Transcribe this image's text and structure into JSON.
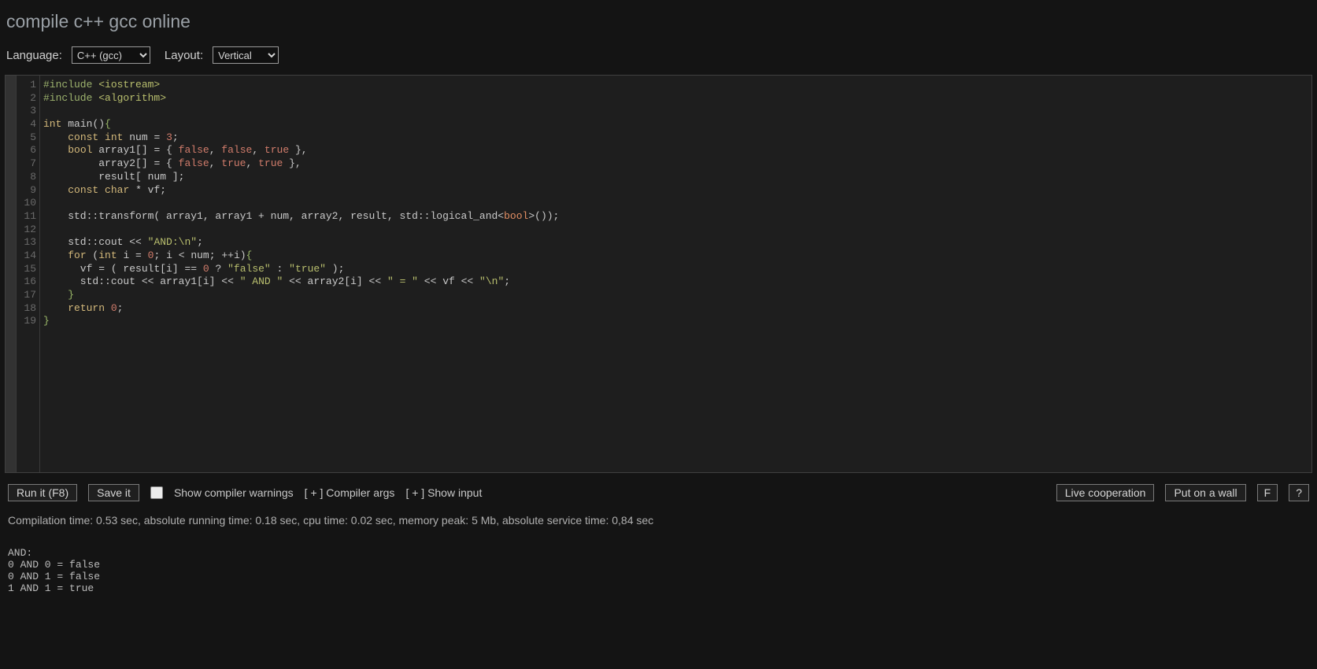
{
  "page": {
    "title": "compile c++ gcc online"
  },
  "toolbar": {
    "language_label": "Language:",
    "language_value": "C++ (gcc)",
    "layout_label": "Layout:",
    "layout_value": "Vertical"
  },
  "editor": {
    "line_count": 19,
    "lines": [
      [
        {
          "t": "#include ",
          "c": "dir"
        },
        {
          "t": "<iostream>",
          "c": "str"
        }
      ],
      [
        {
          "t": "#include ",
          "c": "dir"
        },
        {
          "t": "<algorithm>",
          "c": "str"
        }
      ],
      [
        {
          "t": "",
          "c": "id"
        }
      ],
      [
        {
          "t": "int",
          "c": "type"
        },
        {
          "t": " ",
          "c": "id"
        },
        {
          "t": "main",
          "c": "fn"
        },
        {
          "t": "()",
          "c": "op"
        },
        {
          "t": "{",
          "c": "br"
        }
      ],
      [
        {
          "t": "    ",
          "c": "id"
        },
        {
          "t": "const",
          "c": "kw"
        },
        {
          "t": " ",
          "c": "id"
        },
        {
          "t": "int",
          "c": "type"
        },
        {
          "t": " num ",
          "c": "id"
        },
        {
          "t": "=",
          "c": "op"
        },
        {
          "t": " ",
          "c": "id"
        },
        {
          "t": "3",
          "c": "num"
        },
        {
          "t": ";",
          "c": "op"
        }
      ],
      [
        {
          "t": "    ",
          "c": "id"
        },
        {
          "t": "bool",
          "c": "type"
        },
        {
          "t": " array1[] ",
          "c": "id"
        },
        {
          "t": "=",
          "c": "op"
        },
        {
          "t": " { ",
          "c": "op"
        },
        {
          "t": "false",
          "c": "bool"
        },
        {
          "t": ", ",
          "c": "op"
        },
        {
          "t": "false",
          "c": "bool"
        },
        {
          "t": ", ",
          "c": "op"
        },
        {
          "t": "true",
          "c": "bool"
        },
        {
          "t": " },",
          "c": "op"
        }
      ],
      [
        {
          "t": "         array2[] ",
          "c": "id"
        },
        {
          "t": "=",
          "c": "op"
        },
        {
          "t": " { ",
          "c": "op"
        },
        {
          "t": "false",
          "c": "bool"
        },
        {
          "t": ", ",
          "c": "op"
        },
        {
          "t": "true",
          "c": "bool"
        },
        {
          "t": ", ",
          "c": "op"
        },
        {
          "t": "true",
          "c": "bool"
        },
        {
          "t": " },",
          "c": "op"
        }
      ],
      [
        {
          "t": "         result[ num ];",
          "c": "id"
        }
      ],
      [
        {
          "t": "    ",
          "c": "id"
        },
        {
          "t": "const",
          "c": "kw"
        },
        {
          "t": " ",
          "c": "id"
        },
        {
          "t": "char",
          "c": "type"
        },
        {
          "t": " * vf;",
          "c": "id"
        }
      ],
      [
        {
          "t": "",
          "c": "id"
        }
      ],
      [
        {
          "t": "    std::transform( array1, array1 + num, array2, result, std::logical_and",
          "c": "id"
        },
        {
          "t": "<",
          "c": "op"
        },
        {
          "t": "bool",
          "c": "tmpl"
        },
        {
          "t": ">",
          "c": "op"
        },
        {
          "t": "());",
          "c": "id"
        }
      ],
      [
        {
          "t": "",
          "c": "id"
        }
      ],
      [
        {
          "t": "    std::cout ",
          "c": "id"
        },
        {
          "t": "<<",
          "c": "op"
        },
        {
          "t": " ",
          "c": "id"
        },
        {
          "t": "\"AND:\\n\"",
          "c": "str"
        },
        {
          "t": ";",
          "c": "op"
        }
      ],
      [
        {
          "t": "    ",
          "c": "id"
        },
        {
          "t": "for",
          "c": "kw"
        },
        {
          "t": " (",
          "c": "op"
        },
        {
          "t": "int",
          "c": "type"
        },
        {
          "t": " i ",
          "c": "id"
        },
        {
          "t": "=",
          "c": "op"
        },
        {
          "t": " ",
          "c": "id"
        },
        {
          "t": "0",
          "c": "num"
        },
        {
          "t": "; i ",
          "c": "id"
        },
        {
          "t": "<",
          "c": "op"
        },
        {
          "t": " num; ",
          "c": "id"
        },
        {
          "t": "++",
          "c": "op"
        },
        {
          "t": "i)",
          "c": "id"
        },
        {
          "t": "{",
          "c": "br"
        }
      ],
      [
        {
          "t": "      vf ",
          "c": "id"
        },
        {
          "t": "=",
          "c": "op"
        },
        {
          "t": " ( result[i] ",
          "c": "id"
        },
        {
          "t": "==",
          "c": "op"
        },
        {
          "t": " ",
          "c": "id"
        },
        {
          "t": "0",
          "c": "num"
        },
        {
          "t": " ",
          "c": "id"
        },
        {
          "t": "?",
          "c": "op"
        },
        {
          "t": " ",
          "c": "id"
        },
        {
          "t": "\"false\"",
          "c": "str"
        },
        {
          "t": " ",
          "c": "id"
        },
        {
          "t": ":",
          "c": "op"
        },
        {
          "t": " ",
          "c": "id"
        },
        {
          "t": "\"true\"",
          "c": "str"
        },
        {
          "t": " );",
          "c": "id"
        }
      ],
      [
        {
          "t": "      std::cout ",
          "c": "id"
        },
        {
          "t": "<<",
          "c": "op"
        },
        {
          "t": " array1[i] ",
          "c": "id"
        },
        {
          "t": "<<",
          "c": "op"
        },
        {
          "t": " ",
          "c": "id"
        },
        {
          "t": "\" AND \"",
          "c": "str"
        },
        {
          "t": " ",
          "c": "id"
        },
        {
          "t": "<<",
          "c": "op"
        },
        {
          "t": " array2[i] ",
          "c": "id"
        },
        {
          "t": "<<",
          "c": "op"
        },
        {
          "t": " ",
          "c": "id"
        },
        {
          "t": "\" = \"",
          "c": "str"
        },
        {
          "t": " ",
          "c": "id"
        },
        {
          "t": "<<",
          "c": "op"
        },
        {
          "t": " vf ",
          "c": "id"
        },
        {
          "t": "<<",
          "c": "op"
        },
        {
          "t": " ",
          "c": "id"
        },
        {
          "t": "\"\\n\"",
          "c": "str"
        },
        {
          "t": ";",
          "c": "op"
        }
      ],
      [
        {
          "t": "    ",
          "c": "id"
        },
        {
          "t": "}",
          "c": "br"
        }
      ],
      [
        {
          "t": "    ",
          "c": "id"
        },
        {
          "t": "return",
          "c": "kw"
        },
        {
          "t": " ",
          "c": "id"
        },
        {
          "t": "0",
          "c": "num"
        },
        {
          "t": ";",
          "c": "op"
        }
      ],
      [
        {
          "t": "",
          "c": "id"
        },
        {
          "t": "}",
          "c": "br"
        }
      ]
    ]
  },
  "controls": {
    "run": "Run it (F8)",
    "save": "Save it",
    "show_warnings": "Show compiler warnings",
    "compiler_args_prefix": "[ + ]",
    "compiler_args": "Compiler args",
    "show_input_prefix": "[ + ]",
    "show_input": "Show input",
    "live": "Live cooperation",
    "wall": "Put on a wall",
    "f": "F",
    "q": "?"
  },
  "status": "Compilation time: 0.53 sec, absolute running time: 0.18 sec, cpu time: 0.02 sec, memory peak: 5 Mb, absolute service time: 0,84 sec",
  "output": "AND:\n0 AND 0 = false\n0 AND 1 = false\n1 AND 1 = true"
}
